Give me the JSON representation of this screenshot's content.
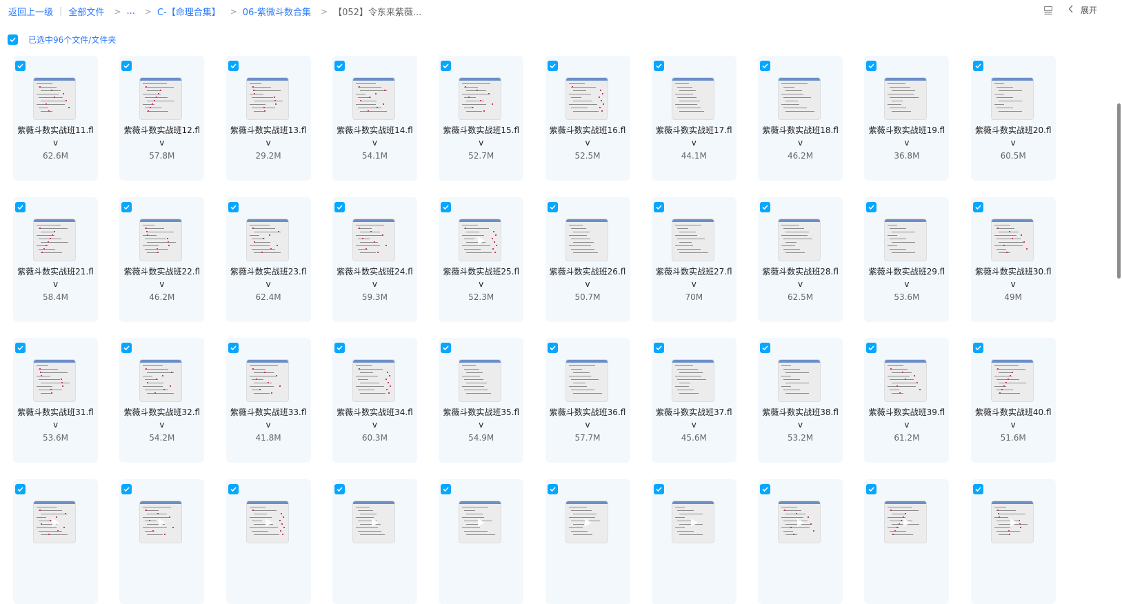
{
  "breadcrumb": {
    "back_label": "返回上一级",
    "all_files_label": "全部文件",
    "ellipsis": "...",
    "folder1": "C-【命理合集】",
    "folder2": "06-紫微斗数合集",
    "current": "【052】令东来紫薇..."
  },
  "toolbar": {
    "expand_label": "展开"
  },
  "selection": {
    "label": "已选中96个文件/文件夹"
  },
  "files": [
    {
      "name": "紫薇斗数实战班11.flv",
      "size": "62.6M"
    },
    {
      "name": "紫薇斗数实战班12.flv",
      "size": "57.8M"
    },
    {
      "name": "紫薇斗数实战班13.flv",
      "size": "29.2M"
    },
    {
      "name": "紫薇斗数实战班14.flv",
      "size": "54.1M"
    },
    {
      "name": "紫薇斗数实战班15.flv",
      "size": "52.7M"
    },
    {
      "name": "紫薇斗数实战班16.flv",
      "size": "52.5M"
    },
    {
      "name": "紫薇斗数实战班17.flv",
      "size": "44.1M"
    },
    {
      "name": "紫薇斗数实战班18.flv",
      "size": "46.2M"
    },
    {
      "name": "紫薇斗数实战班19.flv",
      "size": "36.8M"
    },
    {
      "name": "紫薇斗数实战班20.flv",
      "size": "60.5M"
    },
    {
      "name": "紫薇斗数实战班21.flv",
      "size": "58.4M"
    },
    {
      "name": "紫薇斗数实战班22.flv",
      "size": "46.2M"
    },
    {
      "name": "紫薇斗数实战班23.flv",
      "size": "62.4M"
    },
    {
      "name": "紫薇斗数实战班24.flv",
      "size": "59.3M"
    },
    {
      "name": "紫薇斗数实战班25.flv",
      "size": "52.3M"
    },
    {
      "name": "紫薇斗数实战班26.flv",
      "size": "50.7M"
    },
    {
      "name": "紫薇斗数实战班27.flv",
      "size": "70M"
    },
    {
      "name": "紫薇斗数实战班28.flv",
      "size": "62.5M"
    },
    {
      "name": "紫薇斗数实战班29.flv",
      "size": "53.6M"
    },
    {
      "name": "紫薇斗数实战班30.flv",
      "size": "49M"
    },
    {
      "name": "紫薇斗数实战班31.flv",
      "size": "53.6M"
    },
    {
      "name": "紫薇斗数实战班32.flv",
      "size": "54.2M"
    },
    {
      "name": "紫薇斗数实战班33.flv",
      "size": "41.8M"
    },
    {
      "name": "紫薇斗数实战班34.flv",
      "size": "60.3M"
    },
    {
      "name": "紫薇斗数实战班35.flv",
      "size": "54.9M"
    },
    {
      "name": "紫薇斗数实战班36.flv",
      "size": "57.7M"
    },
    {
      "name": "紫薇斗数实战班37.flv",
      "size": "45.6M"
    },
    {
      "name": "紫薇斗数实战班38.flv",
      "size": "53.2M"
    },
    {
      "name": "紫薇斗数实战班39.flv",
      "size": "61.2M"
    },
    {
      "name": "紫薇斗数实战班40.flv",
      "size": "51.6M"
    },
    {
      "name": "",
      "size": ""
    },
    {
      "name": "",
      "size": ""
    },
    {
      "name": "",
      "size": ""
    },
    {
      "name": "",
      "size": ""
    },
    {
      "name": "",
      "size": ""
    },
    {
      "name": "",
      "size": ""
    },
    {
      "name": "",
      "size": ""
    },
    {
      "name": "",
      "size": ""
    },
    {
      "name": "",
      "size": ""
    },
    {
      "name": "",
      "size": ""
    }
  ],
  "icons": {
    "checkbox": "checkbox-checked-icon",
    "list_view": "list-view-icon",
    "chevron": "chevron-left-icon",
    "play": "play-icon"
  },
  "colors": {
    "accent": "#2979ff",
    "checkbox": "#06a7ff",
    "card_bg": "#f3f8fd"
  }
}
